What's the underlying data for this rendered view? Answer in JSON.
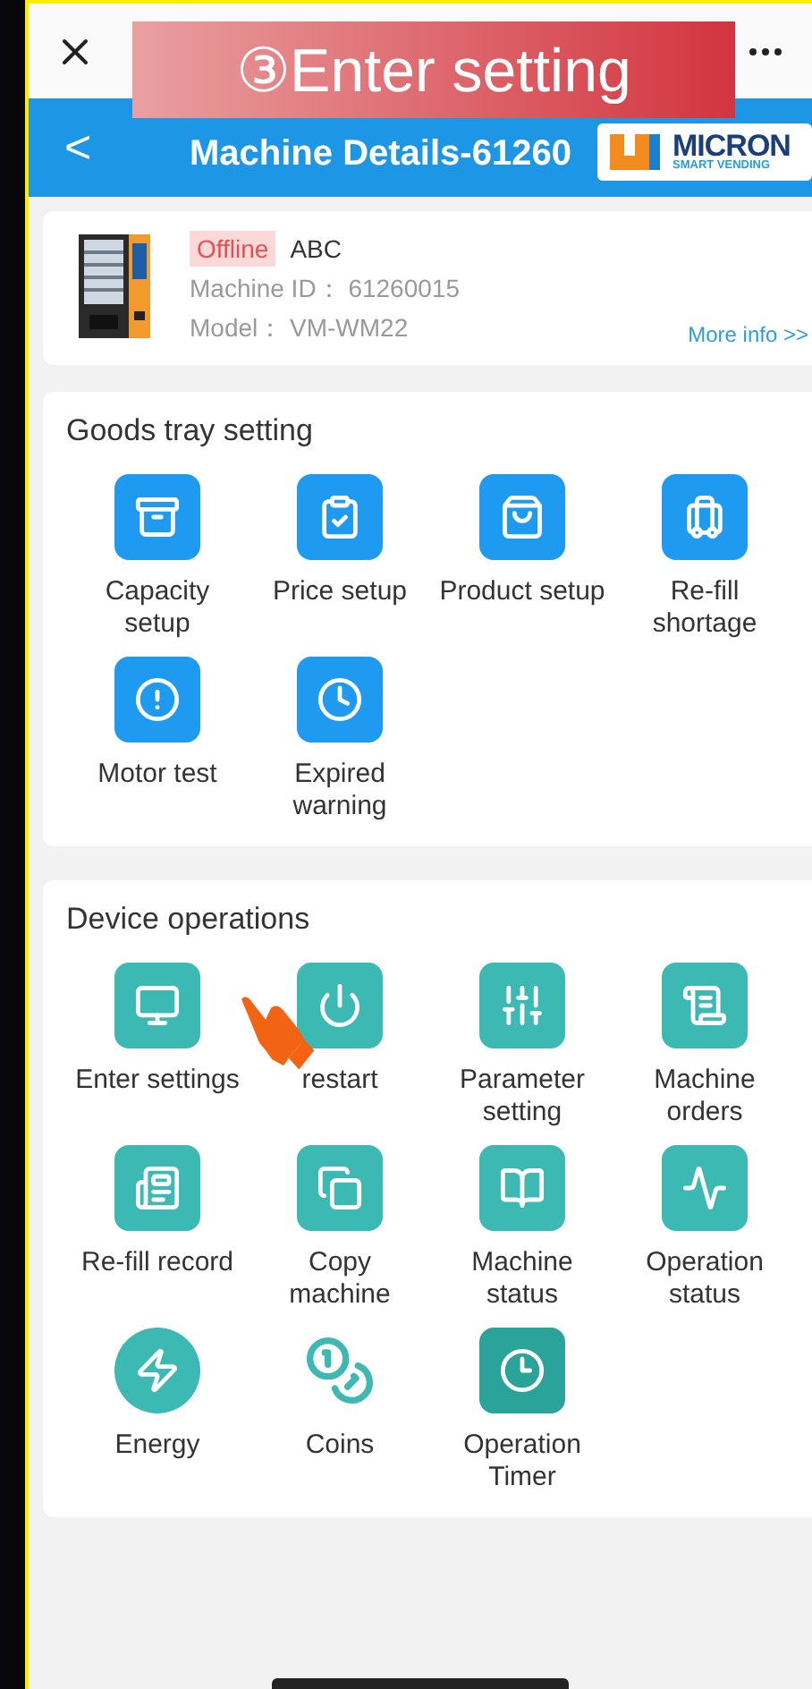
{
  "caption": "③Enter setting",
  "header": {
    "back": "<",
    "title": "Machine Details-61260"
  },
  "logo": {
    "name": "MICRON",
    "tagline": "SMART VENDING"
  },
  "machine": {
    "status": "Offline",
    "name": "ABC",
    "id_line": "Machine ID：  61260015",
    "model_line": "Model：  VM-WM22",
    "more_link": "More info >>"
  },
  "sections": [
    {
      "title": "Goods tray setting",
      "kind": "goods",
      "items": [
        {
          "label": "Capacity setup",
          "kind": "square"
        },
        {
          "label": "Price setup",
          "kind": "square"
        },
        {
          "label": "Product setup",
          "kind": "square"
        },
        {
          "label": "Re-fill shortage",
          "kind": "square"
        },
        {
          "label": "Motor test",
          "kind": "square"
        },
        {
          "label": "Expired warning",
          "kind": "square"
        }
      ]
    },
    {
      "title": "Device operations",
      "kind": "device",
      "items": [
        {
          "label": "Enter settings",
          "kind": "square"
        },
        {
          "label": "restart",
          "kind": "square"
        },
        {
          "label": "Parameter setting",
          "kind": "square"
        },
        {
          "label": "Machine orders",
          "kind": "square"
        },
        {
          "label": "Re-fill record",
          "kind": "square"
        },
        {
          "label": "Copy machine",
          "kind": "square"
        },
        {
          "label": "Machine status",
          "kind": "square"
        },
        {
          "label": "Operation status",
          "kind": "square"
        },
        {
          "label": "Energy",
          "kind": "circle"
        },
        {
          "label": "Coins",
          "kind": "outline"
        },
        {
          "label": "Operation Timer",
          "kind": "dark"
        }
      ]
    }
  ]
}
